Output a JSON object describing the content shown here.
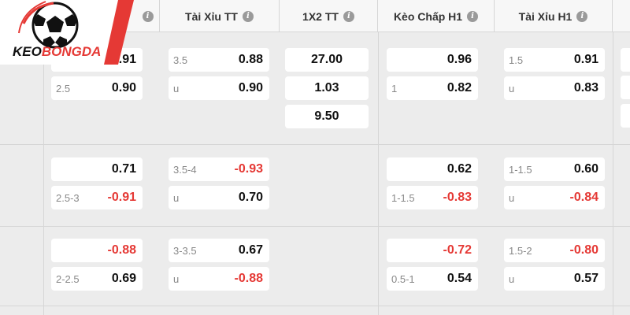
{
  "brand": {
    "name": "KEOBONGDA",
    "accent": "#e53935"
  },
  "columns": [
    {
      "label": "Tài Xỉu TT"
    },
    {
      "label": "1X2 TT"
    },
    {
      "label": "Kèo Chấp H1"
    },
    {
      "label": "Tài Xỉu H1"
    }
  ],
  "rows": [
    {
      "keo_chap": [
        {
          "line": "",
          "value": "0.91"
        },
        {
          "line": "2.5",
          "value": "0.90"
        }
      ],
      "tai_xiu": [
        {
          "line": "3.5",
          "value": "0.88"
        },
        {
          "line": "u",
          "value": "0.90"
        }
      ],
      "x12": [
        "27.00",
        "1.03",
        "9.50"
      ],
      "keo_chap_h1": [
        {
          "line": "",
          "value": "0.96"
        },
        {
          "line": "1",
          "value": "0.82"
        }
      ],
      "tai_xiu_h1": [
        {
          "line": "1.5",
          "value": "0.91"
        },
        {
          "line": "u",
          "value": "0.83"
        }
      ]
    },
    {
      "keo_chap": [
        {
          "line": "",
          "value": "0.71"
        },
        {
          "line": "2.5-3",
          "value": "-0.91"
        }
      ],
      "tai_xiu": [
        {
          "line": "3.5-4",
          "value": "-0.93"
        },
        {
          "line": "u",
          "value": "0.70"
        }
      ],
      "x12": [],
      "keo_chap_h1": [
        {
          "line": "",
          "value": "0.62"
        },
        {
          "line": "1-1.5",
          "value": "-0.83"
        }
      ],
      "tai_xiu_h1": [
        {
          "line": "1-1.5",
          "value": "0.60"
        },
        {
          "line": "u",
          "value": "-0.84"
        }
      ]
    },
    {
      "keo_chap": [
        {
          "line": "",
          "value": "-0.88"
        },
        {
          "line": "2-2.5",
          "value": "0.69"
        }
      ],
      "tai_xiu": [
        {
          "line": "3-3.5",
          "value": "0.67"
        },
        {
          "line": "u",
          "value": "-0.88"
        }
      ],
      "x12": [],
      "keo_chap_h1": [
        {
          "line": "",
          "value": "-0.72"
        },
        {
          "line": "0.5-1",
          "value": "0.54"
        }
      ],
      "tai_xiu_h1": [
        {
          "line": "1.5-2",
          "value": "-0.80"
        },
        {
          "line": "u",
          "value": "0.57"
        }
      ]
    }
  ]
}
